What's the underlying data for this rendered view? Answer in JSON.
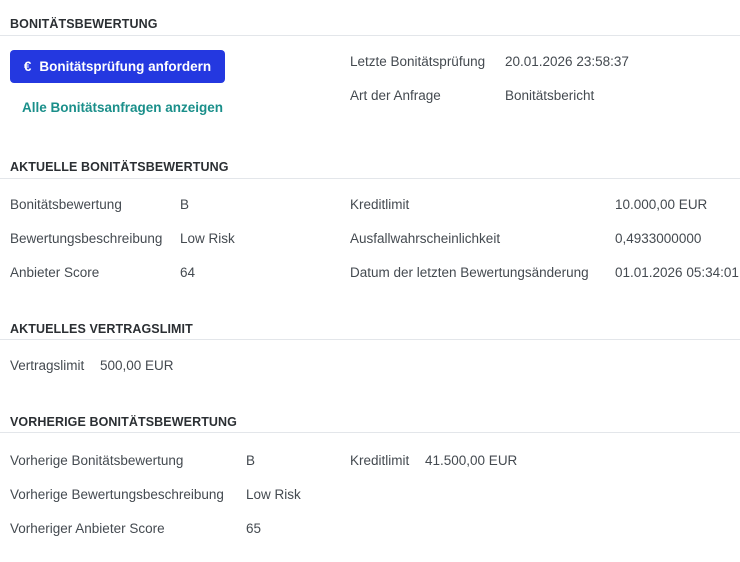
{
  "header": {
    "title": "BONITÄTSBEWERTUNG"
  },
  "actions": {
    "request_button_icon": "€",
    "request_button_label": "Bonitätsprüfung anfordern",
    "show_all_link": "Alle Bonitätsanfragen anzeigen"
  },
  "last_check": {
    "date_label": "Letzte Bonitätsprüfung",
    "date_value": "20.01.2026 23:58:37",
    "type_label": "Art der Anfrage",
    "type_value": "Bonitätsbericht"
  },
  "current_rating": {
    "title": "AKTUELLE BONITÄTSBEWERTUNG",
    "rating_label": "Bonitätsbewertung",
    "rating_value": "B",
    "description_label": "Bewertungsbeschreibung",
    "description_value": "Low Risk",
    "provider_score_label": "Anbieter Score",
    "provider_score_value": "64",
    "credit_limit_label": "Kreditlimit",
    "credit_limit_value": "10.000,00  EUR",
    "default_prob_label": "Ausfallwahrscheinlichkeit",
    "default_prob_value": "0,4933000000",
    "last_change_label": "Datum der letzten Bewertungsänderung",
    "last_change_value": "01.01.2026 05:34:01"
  },
  "contract_limit": {
    "title": "AKTUELLES VERTRAGSLIMIT",
    "label": "Vertragslimit",
    "value": "500,00  EUR"
  },
  "previous_rating": {
    "title": "VORHERIGE BONITÄTSBEWERTUNG",
    "rating_label": "Vorherige Bonitätsbewertung",
    "rating_value": "B",
    "description_label": "Vorherige Bewertungsbeschreibung",
    "description_value": "Low Risk",
    "provider_score_label": "Vorheriger Anbieter Score",
    "provider_score_value": "65",
    "credit_limit_label": "Kreditlimit",
    "credit_limit_value": "41.500,00  EUR"
  },
  "colors": {
    "primary_button": "#2438e0",
    "link": "#1a8f8a",
    "divider": "#e3e6ea"
  }
}
